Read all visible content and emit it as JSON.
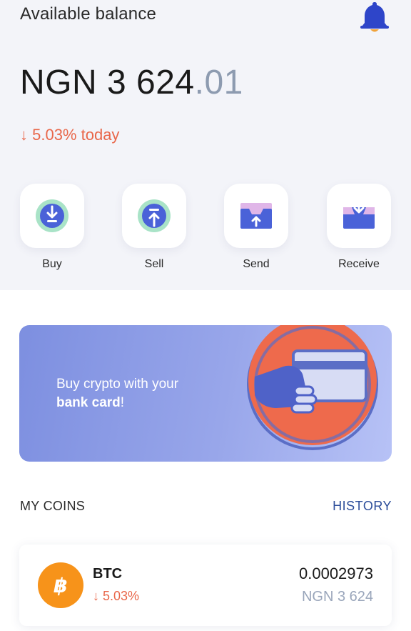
{
  "header": {
    "title": "Available balance",
    "notification_icon": "bell-icon"
  },
  "balance": {
    "whole": "NGN 3 624",
    "decimal": ".01",
    "change": "↓ 5.03% today"
  },
  "actions": [
    {
      "label": "Buy",
      "icon": "buy-download-icon"
    },
    {
      "label": "Sell",
      "icon": "sell-upload-icon"
    },
    {
      "label": "Send",
      "icon": "send-box-icon"
    },
    {
      "label": "Receive",
      "icon": "receive-box-icon"
    }
  ],
  "banner": {
    "line1": "Buy crypto with your",
    "line2_bold": "bank card",
    "line2_rest": "!"
  },
  "coins_section": {
    "title": "MY COINS",
    "history": "HISTORY"
  },
  "coins": [
    {
      "symbol": "BTC",
      "logo_text": "฿",
      "change": "↓ 5.03%",
      "quantity": "0.0002973",
      "fiat": "NGN 3 624"
    }
  ],
  "colors": {
    "accent_blue": "#2c4d9a",
    "negative": "#e9674a",
    "banner_start": "#7d8fe0",
    "banner_end": "#b7c2f6",
    "btc_orange": "#f7931a"
  }
}
